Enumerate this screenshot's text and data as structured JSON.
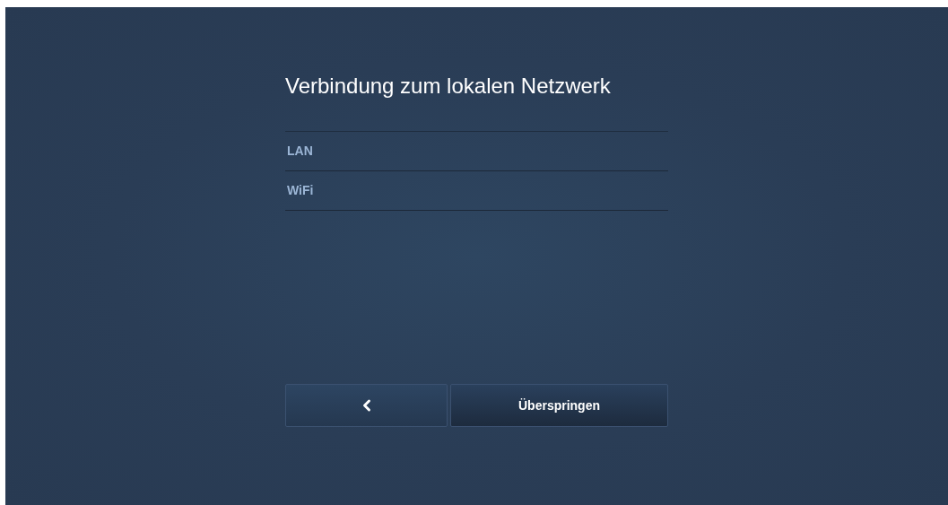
{
  "title": "Verbindung zum lokalen Netzwerk",
  "options": [
    {
      "label": "LAN"
    },
    {
      "label": "WiFi"
    }
  ],
  "buttons": {
    "skip": "Überspringen"
  }
}
